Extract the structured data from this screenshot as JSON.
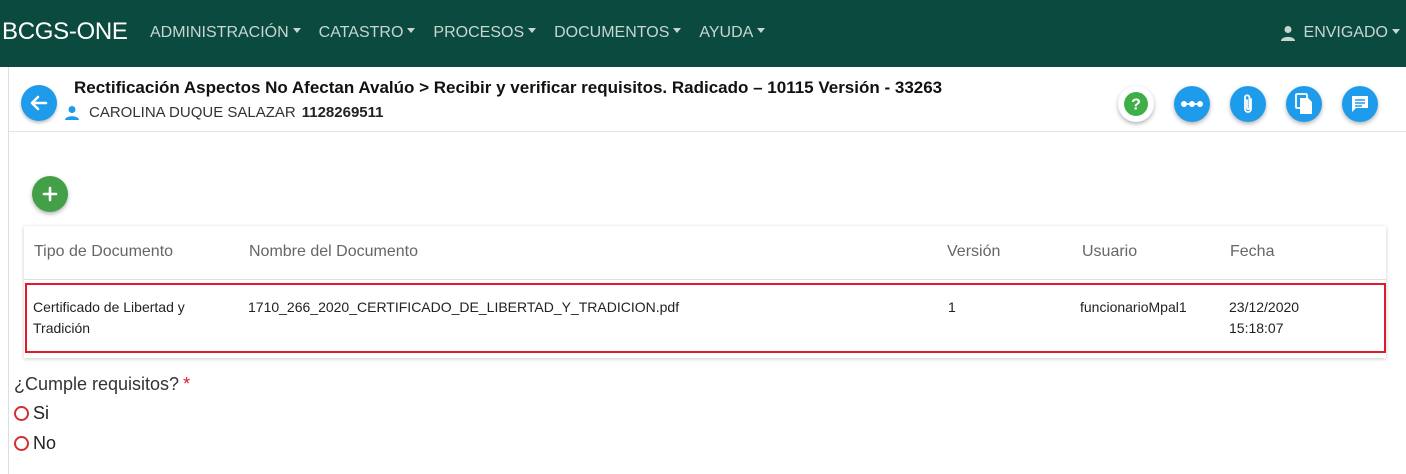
{
  "navbar": {
    "brand": "BCGS-ONE",
    "menu": [
      {
        "label": "ADMINISTRACIÓN"
      },
      {
        "label": "CATASTRO"
      },
      {
        "label": "PROCESOS"
      },
      {
        "label": "DOCUMENTOS"
      },
      {
        "label": "AYUDA"
      }
    ],
    "user": "ENVIGADO"
  },
  "header": {
    "title": "Rectificación Aspectos No Afectan Avalúo > Recibir y verificar requisitos. Radicado – 10115 Versión - 33263",
    "person_name": "CAROLINA DUQUE SALAZAR",
    "person_id": "1128269511"
  },
  "toolbar": {
    "icons": [
      "help-icon",
      "workflow-icon",
      "attachment-icon",
      "copy-icon",
      "comments-icon"
    ]
  },
  "table": {
    "columns": [
      "Tipo de Documento",
      "Nombre del Documento",
      "Versión",
      "Usuario",
      "Fecha"
    ],
    "rows": [
      {
        "tipo": "Certificado de Libertad y Tradición",
        "nombre": "1710_266_2020_CERTIFICADO_DE_LIBERTAD_Y_TRADICION.pdf",
        "version": "1",
        "usuario": "funcionarioMpal1",
        "fecha_date": "23/12/2020",
        "fecha_time": "15:18:07"
      }
    ]
  },
  "form": {
    "question": "¿Cumple requisitos?",
    "required_mark": "*",
    "options": [
      "Si",
      "No"
    ]
  },
  "colors": {
    "navbar_bg": "#0b4a3f",
    "primary_button": "#1e9bea",
    "add_button": "#43a047",
    "highlight_border": "#e0192c"
  }
}
